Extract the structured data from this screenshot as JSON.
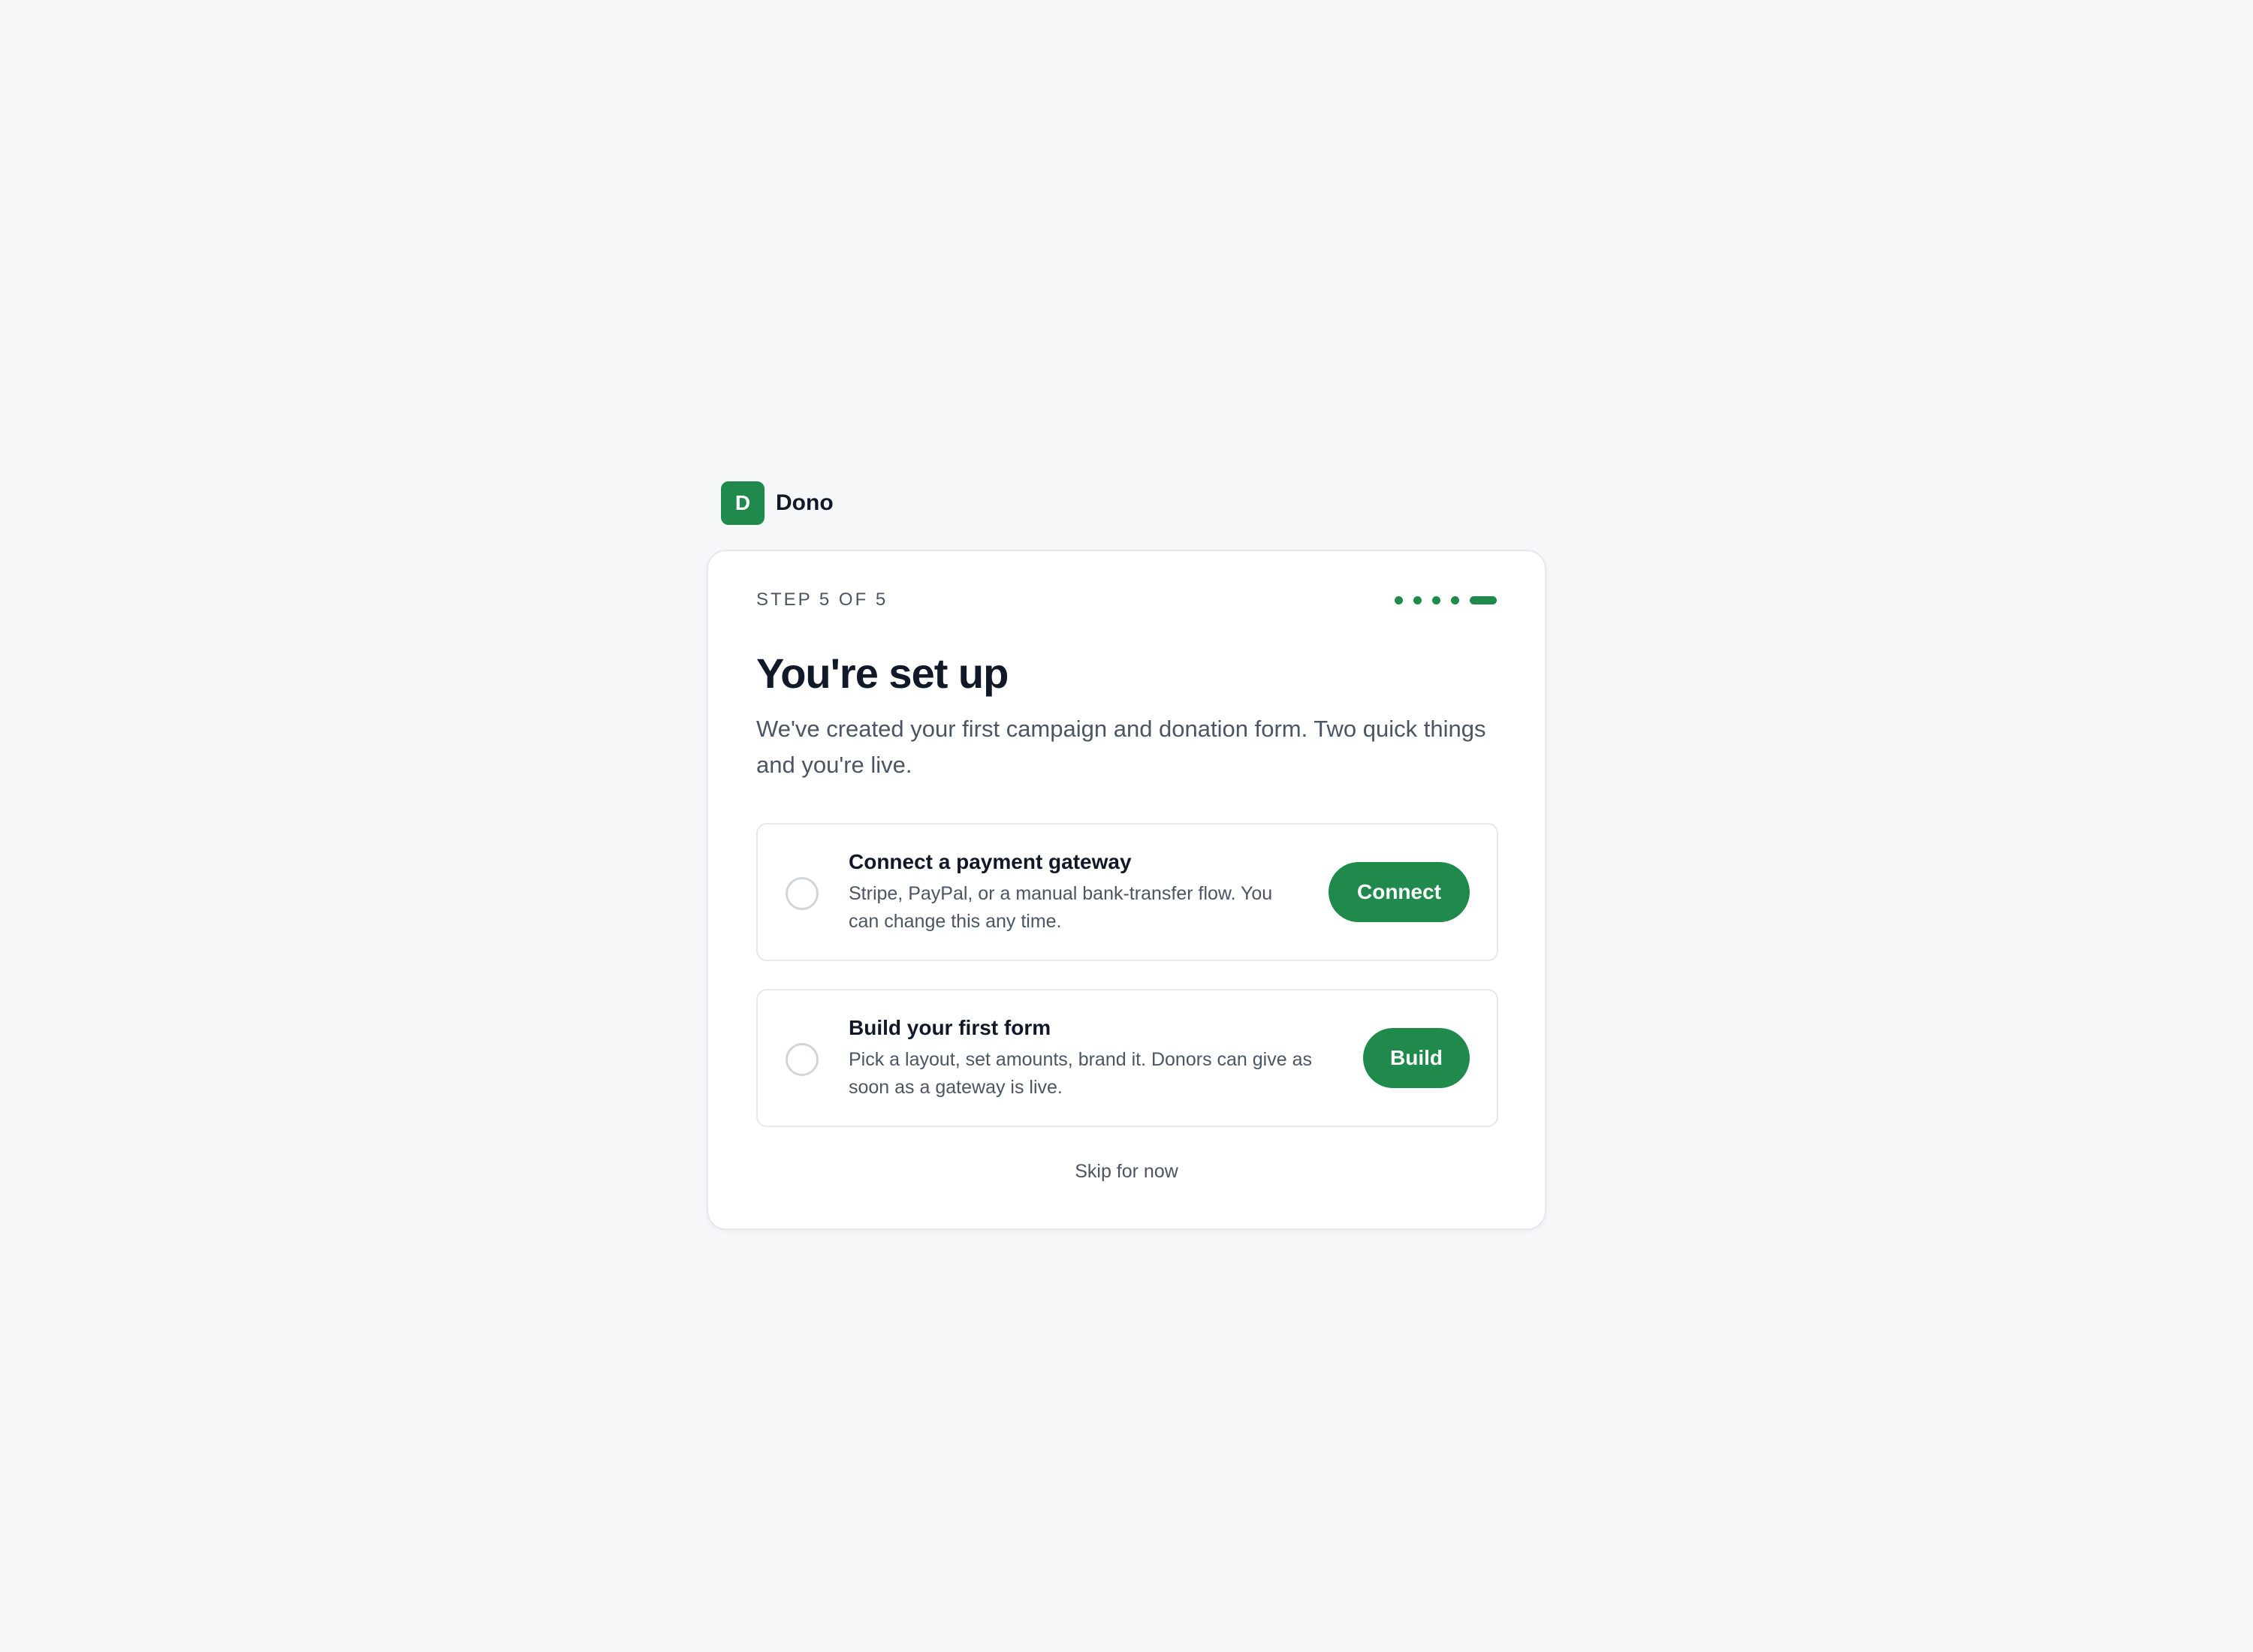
{
  "brand": {
    "logo_letter": "D",
    "name": "Dono"
  },
  "header": {
    "step_label": "STEP 5 OF 5",
    "total_steps": 5,
    "current_step": 5
  },
  "main": {
    "title": "You're set up",
    "subtitle": "We've created your first campaign and donation form. Two quick things and you're live."
  },
  "tasks": [
    {
      "title": "Connect a payment gateway",
      "description": "Stripe, PayPal, or a manual bank-transfer flow. You can change this any time.",
      "button_label": "Connect",
      "completed": false
    },
    {
      "title": "Build your first form",
      "description": "Pick a layout, set amounts, brand it. Donors can give as soon as a gateway is live.",
      "button_label": "Build",
      "completed": false
    }
  ],
  "footer": {
    "skip_label": "Skip for now"
  },
  "colors": {
    "accent": "#1f8a4c",
    "background": "#f6f7f9",
    "muted_text": "#4b5563"
  }
}
